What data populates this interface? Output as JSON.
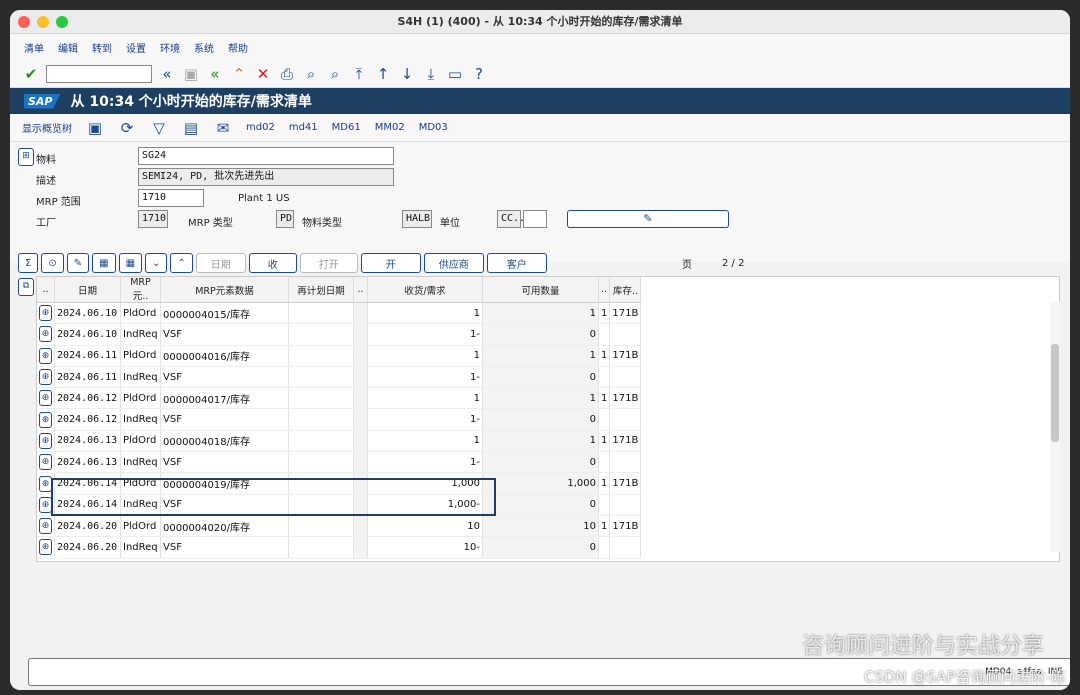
{
  "window": {
    "title": "S4H (1) (400) - 从 10:34 个小时开始的库存/需求清单"
  },
  "menu": [
    "清单",
    "编辑",
    "转到",
    "设置",
    "环境",
    "系统",
    "帮助"
  ],
  "header": {
    "logo": "SAP",
    "title": "从 10:34 个小时开始的库存/需求清单"
  },
  "apptoolbar": {
    "overview_tree": "显示概览树",
    "tx": [
      "md02",
      "md41",
      "MD61",
      "MM02",
      "MD03"
    ]
  },
  "form": {
    "material_label": "物料",
    "material_value": "SG24",
    "desc_label": "描述",
    "desc_value": "SEMI24, PD, 批次先进先出",
    "mrp_area_label": "MRP 范围",
    "mrp_area_value": "1710",
    "mrp_area_text": "Plant 1 US",
    "plant_label": "工厂",
    "plant_value": "1710",
    "mrp_type_label": "MRP 类型",
    "mrp_type_value": "PD",
    "mat_type_label": "物料类型",
    "mat_type_value": "HALB",
    "unit_label": "单位",
    "unit_value": "CC.."
  },
  "grid_toolbar": {
    "date_btn": "日期",
    "receipt_btn": "收",
    "open_btn": "打开",
    "open2_btn": "开",
    "vendor_btn": "供应商",
    "customer_btn": "客户",
    "page_label": "页",
    "page_value": "2 /  2"
  },
  "columns": [
    "..",
    "日期",
    "MRP 元..",
    "MRP元素数据",
    "再计划日期",
    "..",
    "收货/需求",
    "可用数量",
    "..",
    "库存.."
  ],
  "rows": [
    {
      "date": "2024.06.10",
      "mrp": "PldOrd",
      "data": "0000004015/库存",
      "qty": "1",
      "avail": "1",
      "flag": "1",
      "stor": "171B"
    },
    {
      "date": "2024.06.10",
      "mrp": "IndReq",
      "data": "VSF",
      "qty": "1-",
      "avail": "0",
      "flag": "",
      "stor": ""
    },
    {
      "date": "2024.06.11",
      "mrp": "PldOrd",
      "data": "0000004016/库存",
      "qty": "1",
      "avail": "1",
      "flag": "1",
      "stor": "171B"
    },
    {
      "date": "2024.06.11",
      "mrp": "IndReq",
      "data": "VSF",
      "qty": "1-",
      "avail": "0",
      "flag": "",
      "stor": ""
    },
    {
      "date": "2024.06.12",
      "mrp": "PldOrd",
      "data": "0000004017/库存",
      "qty": "1",
      "avail": "1",
      "flag": "1",
      "stor": "171B"
    },
    {
      "date": "2024.06.12",
      "mrp": "IndReq",
      "data": "VSF",
      "qty": "1-",
      "avail": "0",
      "flag": "",
      "stor": ""
    },
    {
      "date": "2024.06.13",
      "mrp": "PldOrd",
      "data": "0000004018/库存",
      "qty": "1",
      "avail": "1",
      "flag": "1",
      "stor": "171B"
    },
    {
      "date": "2024.06.13",
      "mrp": "IndReq",
      "data": "VSF",
      "qty": "1-",
      "avail": "0",
      "flag": "",
      "stor": ""
    },
    {
      "date": "2024.06.14",
      "mrp": "PldOrd",
      "data": "0000004019/库存",
      "qty": "1,000",
      "avail": "1,000",
      "flag": "1",
      "stor": "171B"
    },
    {
      "date": "2024.06.14",
      "mrp": "IndReq",
      "data": "VSF",
      "qty": "1,000-",
      "avail": "0",
      "flag": "",
      "stor": ""
    },
    {
      "date": "2024.06.20",
      "mrp": "PldOrd",
      "data": "0000004020/库存",
      "qty": "10",
      "avail": "10",
      "flag": "1",
      "stor": "171B"
    },
    {
      "date": "2024.06.20",
      "mrp": "IndReq",
      "data": "VSF",
      "qty": "10-",
      "avail": "0",
      "flag": "",
      "stor": ""
    }
  ],
  "status": {
    "tcode": "MD04",
    "server": "s4faa",
    "mode": "INS"
  },
  "watermark": {
    "line1": "咨询顾问进阶与实战分享",
    "line2": "CSDN @SAP咨询顾问进阶-陈"
  }
}
